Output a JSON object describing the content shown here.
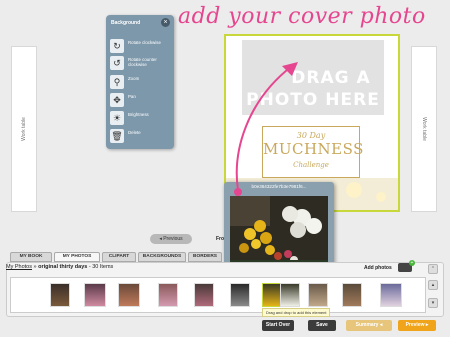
{
  "annotation": "add your cover photo",
  "side_tables": {
    "left": "Work table",
    "right": "Work table"
  },
  "background_panel": {
    "title": "Background",
    "close": "×",
    "items": [
      {
        "label": "Rotate clockwise",
        "icon": "rotate-clockwise-icon",
        "glyph": "↻"
      },
      {
        "label": "Rotate counter clockwise",
        "icon": "rotate-counter-clockwise-icon",
        "glyph": "↺"
      },
      {
        "label": "Zoom",
        "icon": "zoom-icon",
        "glyph": "⚲"
      },
      {
        "label": "Pan",
        "icon": "pan-icon",
        "glyph": "✥"
      },
      {
        "label": "Brightness",
        "icon": "brightness-icon",
        "glyph": "☀"
      },
      {
        "label": "Delete",
        "icon": "trash-icon",
        "glyph": "🗑"
      }
    ]
  },
  "page": {
    "drop_line1": "DRAG A",
    "drop_line2": "PHOTO HERE",
    "title_line1": "30 Day",
    "title_line2": "MUCHNESS",
    "title_line3": "Challenge"
  },
  "drag_card": {
    "filename": "b0e364322fe7b3e7981f6..."
  },
  "previous_button": "◂ Previous",
  "fro_text": "Fro",
  "tabs": [
    "MY BOOK",
    "MY PHOTOS",
    "CLIPART",
    "BACKGROUNDS",
    "BORDERS"
  ],
  "active_tab": "MY PHOTOS",
  "breadcrumb": {
    "link": "My Photos",
    "sep": "»",
    "album": "original thirty days",
    "count": "- 30 Items"
  },
  "add_photos": "Add photos",
  "thumb_tooltip": "Drag and drop to add this element",
  "footer": {
    "start_over": "Start Over",
    "save": "Save",
    "summary": "Summary ◂",
    "preview": "Preview ▸"
  },
  "colors": {
    "accent_pink": "#e5468f",
    "panel_blue": "#7d98ab",
    "page_border": "#c8d83a",
    "preview": "#f0a41b"
  }
}
